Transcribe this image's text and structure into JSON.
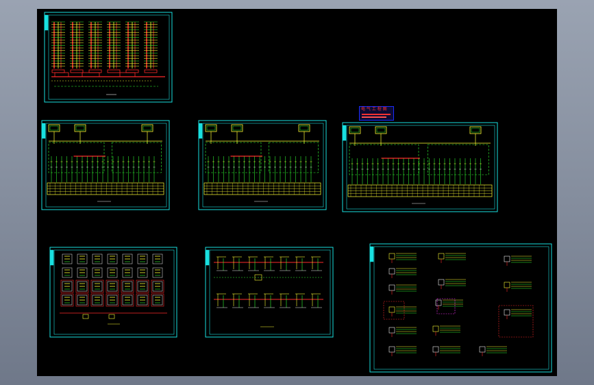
{
  "app": {
    "viewport_background": "#000000",
    "frame_color": "#19e0e0"
  },
  "sheets": [
    {
      "id": "riser-diagram",
      "kind": "riser",
      "frame_color": "#19e0e0"
    },
    {
      "id": "distribution-panel-1",
      "kind": "panel"
    },
    {
      "id": "distribution-panel-2",
      "kind": "panel"
    },
    {
      "id": "distribution-panel-3",
      "kind": "panel"
    },
    {
      "id": "floor-plan-grid",
      "kind": "grid"
    },
    {
      "id": "circuit-layout",
      "kind": "circuit"
    },
    {
      "id": "detail-legend-sheet",
      "kind": "legend"
    }
  ],
  "colors": {
    "yellow": "#ffff33",
    "red": "#ff2a2a",
    "green": "#33ff33",
    "cyan": "#19e0e0",
    "white": "#f2f2f2",
    "magenta": "#ff33ff"
  },
  "title_tag": {
    "text": "电 气 工 程 图",
    "border_color": "#1c2cff"
  }
}
